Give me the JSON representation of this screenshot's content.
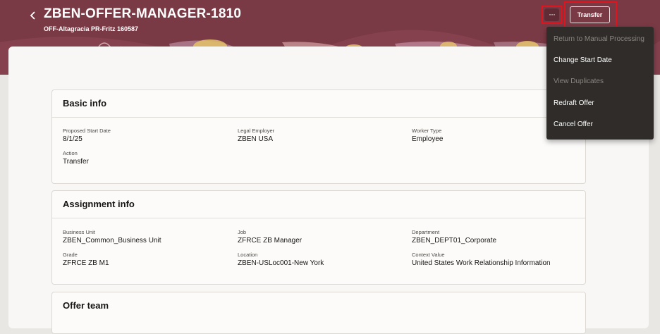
{
  "header": {
    "back_icon": "chevron-left-icon",
    "title": "ZBEN-OFFER-MANAGER-1810",
    "subtitle": "OFF-Altagracia PR-Fritz 160587",
    "more_label": "···",
    "transfer_label": "Transfer",
    "highlight_color": "#e0141c",
    "banner_color": "#7a3a45"
  },
  "menu": {
    "items": [
      {
        "label": "Return to Manual Processing",
        "enabled": false
      },
      {
        "label": "Change Start Date",
        "enabled": true
      },
      {
        "label": "View Duplicates",
        "enabled": false
      },
      {
        "label": "Redraft Offer",
        "enabled": true
      },
      {
        "label": "Cancel Offer",
        "enabled": true
      }
    ]
  },
  "basic_info": {
    "title": "Basic info",
    "proposed_start_date": {
      "label": "Proposed Start Date",
      "value": "8/1/25"
    },
    "legal_employer": {
      "label": "Legal Employer",
      "value": "ZBEN USA"
    },
    "worker_type": {
      "label": "Worker Type",
      "value": "Employee"
    },
    "action": {
      "label": "Action",
      "value": "Transfer"
    }
  },
  "assignment_info": {
    "title": "Assignment info",
    "business_unit": {
      "label": "Business Unit",
      "value": "ZBEN_Common_Business Unit"
    },
    "job": {
      "label": "Job",
      "value": "ZFRCE ZB Manager"
    },
    "department": {
      "label": "Department",
      "value": "ZBEN_DEPT01_Corporate"
    },
    "grade": {
      "label": "Grade",
      "value": "ZFRCE ZB M1"
    },
    "location": {
      "label": "Location",
      "value": "ZBEN-USLoc001-New York"
    },
    "context_value": {
      "label": "Context Value",
      "value": "United States Work Relationship Information"
    }
  },
  "offer_team": {
    "title": "Offer team"
  }
}
